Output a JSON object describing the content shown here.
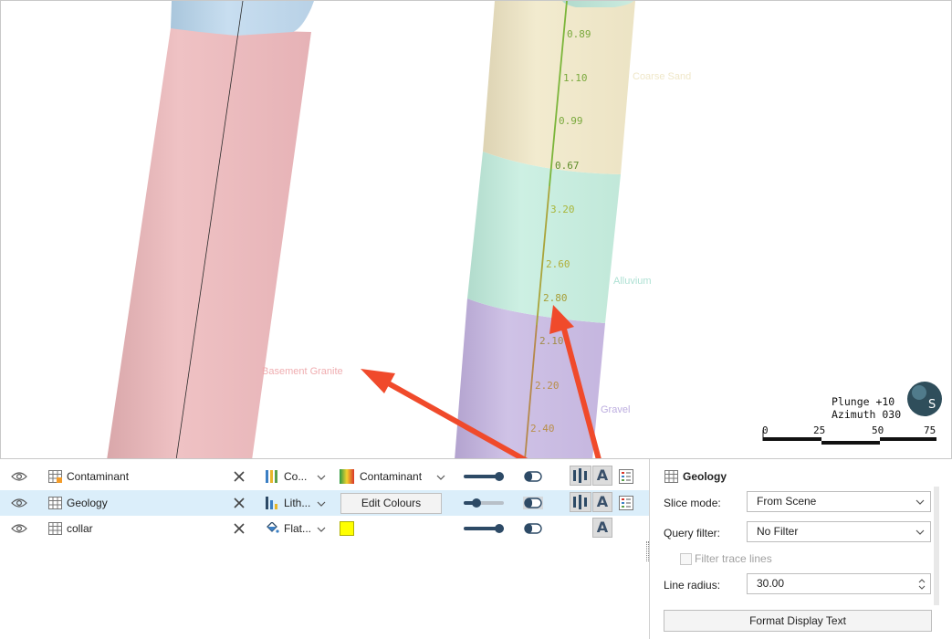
{
  "viewport": {
    "depth_labels_right": [
      "0.89",
      "1.10",
      "0.99",
      "0.67",
      "3.20",
      "2.60",
      "2.80",
      "2.10",
      "2.20",
      "2.40"
    ],
    "unit_labels": [
      "Coarse Sand",
      "Alluvium",
      "Basement Granite",
      "Gravel"
    ],
    "orientation": {
      "plunge": "Plunge +10",
      "azimuth": "Azimuth 030"
    },
    "scale_bar": [
      "0",
      "25",
      "50",
      "75"
    ]
  },
  "layers": {
    "rows": [
      {
        "name": "Contaminant",
        "mode_label": "Co...",
        "value_label": "Contaminant",
        "icon": "gradient-icon"
      },
      {
        "name": "Geology",
        "mode_label": "Lith...",
        "button_label": "Edit Colours",
        "icon": "lithology-icon"
      },
      {
        "name": "collar",
        "mode_label": "Flat...",
        "swatch_color": "#ffff00",
        "icon": "paint-bucket-icon"
      }
    ]
  },
  "properties": {
    "title": "Geology",
    "slice_mode_label": "Slice mode:",
    "slice_mode_value": "From Scene",
    "query_filter_label": "Query filter:",
    "query_filter_value": "No Filter",
    "filter_trace_lines_label": "Filter trace lines",
    "line_radius_label": "Line radius:",
    "line_radius_value": "30.00",
    "format_button": "Format Display Text"
  },
  "colors": {
    "accent_arrow": "#f04a2b",
    "selected_row": "#dbeefa",
    "slider": "#2d4a66"
  }
}
